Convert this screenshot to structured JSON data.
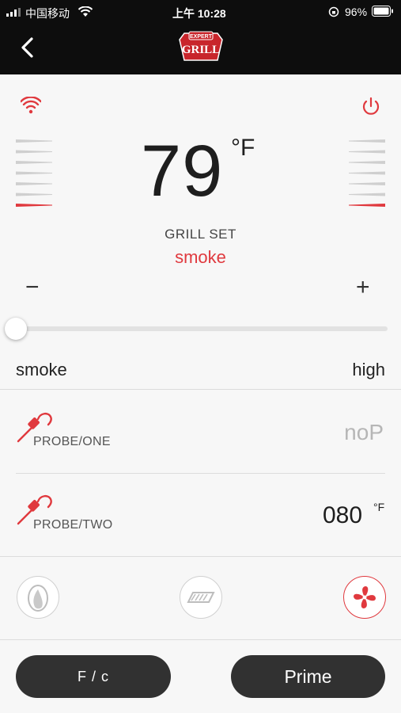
{
  "status_bar": {
    "carrier": "中国移动",
    "time": "上午 10:28",
    "battery": "96%"
  },
  "nav": {
    "back_icon": "chevron-left-icon",
    "logo_top": "EXPERT",
    "logo_main": "GRILL"
  },
  "grill": {
    "temperature": "79",
    "unit": "°F",
    "set_label": "GRILL SET",
    "mode": "smoke",
    "minus": "−",
    "plus": "+",
    "slider": {
      "min_label": "smoke",
      "max_label": "high",
      "position": 0
    }
  },
  "probes": [
    {
      "label": "PROBE/ONE",
      "reading": "noP"
    },
    {
      "label": "PROBE/TWO",
      "reading": "080",
      "unit": "°F"
    }
  ],
  "controls": {
    "icons": [
      "ignitor-icon",
      "grate-icon",
      "fan-icon"
    ]
  },
  "buttons": {
    "fc": "F / c",
    "prime": "Prime"
  },
  "colors": {
    "accent": "#e0393e",
    "bar": "#0d0d0d",
    "button": "#313131"
  }
}
